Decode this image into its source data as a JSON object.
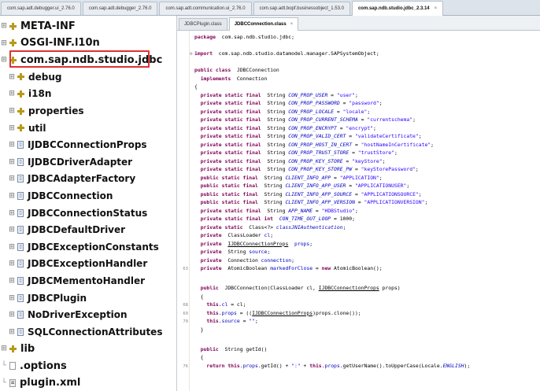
{
  "top_tabs": [
    {
      "label": "com.sap.adt.debugger.ui_2.76.0",
      "active": false
    },
    {
      "label": "com.sap.adt.debugger_2.76.0",
      "active": false
    },
    {
      "label": "com.sap.adt.communication.ui_2.76.0",
      "active": false
    },
    {
      "label": "com.sap.adt.bopf.businessobject_1.53.0",
      "active": false
    },
    {
      "label": "com.sap.ndb.studio.jdbc_2.3.14",
      "active": true,
      "close": "×"
    }
  ],
  "tree": [
    {
      "label": "META-INF",
      "icon": "package-icon",
      "level": 0
    },
    {
      "label": "OSGI-INF.l10n",
      "icon": "package-icon",
      "level": 0
    },
    {
      "label": "com.sap.ndb.studio.jdbc",
      "icon": "package-icon",
      "level": 0,
      "selected": true
    },
    {
      "label": "debug",
      "icon": "package-icon",
      "level": 1
    },
    {
      "label": "i18n",
      "icon": "package-icon",
      "level": 1
    },
    {
      "label": "properties",
      "icon": "package-icon",
      "level": 1
    },
    {
      "label": "util",
      "icon": "package-icon",
      "level": 1
    },
    {
      "label": "IJDBCConnectionProps",
      "icon": "class-file-icon",
      "level": 1
    },
    {
      "label": "IJDBCDriverAdapter",
      "icon": "class-file-icon",
      "level": 1
    },
    {
      "label": "JDBCAdapterFactory",
      "icon": "class-file-icon",
      "level": 1
    },
    {
      "label": "JDBCConnection",
      "icon": "class-file-icon",
      "level": 1
    },
    {
      "label": "JDBCConnectionStatus",
      "icon": "class-file-icon",
      "level": 1
    },
    {
      "label": "JDBCDefaultDriver",
      "icon": "class-file-icon",
      "level": 1
    },
    {
      "label": "JDBCExceptionConstants",
      "icon": "class-file-icon",
      "level": 1
    },
    {
      "label": "JDBCExceptionHandler",
      "icon": "class-file-icon",
      "level": 1
    },
    {
      "label": "JDBCMementoHandler",
      "icon": "class-file-icon",
      "level": 1
    },
    {
      "label": "JDBCPlugin",
      "icon": "class-file-icon",
      "level": 1
    },
    {
      "label": "NoDriverException",
      "icon": "class-file-icon",
      "level": 1
    },
    {
      "label": "SQLConnectionAttributes",
      "icon": "class-file-icon",
      "level": 1
    },
    {
      "label": "lib",
      "icon": "package-icon",
      "level": 0
    },
    {
      "label": ".options",
      "icon": "file-icon",
      "level": 0
    },
    {
      "label": "plugin.xml",
      "icon": "xml-file-icon",
      "level": 0
    }
  ],
  "editor_tabs": [
    {
      "label": "JDBCPlugin.class",
      "active": false
    },
    {
      "label": "JDBCConnection.class",
      "active": true,
      "close": "×"
    }
  ],
  "code_lines": [
    {
      "ln": "",
      "fold": "",
      "t": [
        [
          "kw",
          "package"
        ],
        [
          "",
          "  com.sap.ndb.studio.jdbc;"
        ]
      ]
    },
    {
      "ln": "",
      "fold": "",
      "t": []
    },
    {
      "ln": "",
      "fold": "⊕",
      "t": [
        [
          "kw",
          "import"
        ],
        [
          "",
          "  com.sap.ndb.studio.datamodel.manager.SAPSystemObject;"
        ]
      ]
    },
    {
      "ln": "",
      "fold": "",
      "t": []
    },
    {
      "ln": "",
      "fold": "",
      "t": [
        [
          "kw",
          "public class"
        ],
        [
          "",
          "  JDBCConnection"
        ]
      ]
    },
    {
      "ln": "",
      "fold": "",
      "t": [
        [
          "",
          "  "
        ],
        [
          "kw",
          "implements"
        ],
        [
          "",
          "  Connection"
        ]
      ]
    },
    {
      "ln": "",
      "fold": "",
      "t": [
        [
          "",
          "{"
        ]
      ]
    },
    {
      "ln": "",
      "fold": "",
      "t": [
        [
          "kw",
          "  private static final"
        ],
        [
          "",
          "  String "
        ],
        [
          "fld",
          "CON_PROP_USER"
        ],
        [
          "",
          " = "
        ],
        [
          "str",
          "\"user\""
        ],
        [
          "",
          ";"
        ]
      ]
    },
    {
      "ln": "",
      "fold": "",
      "t": [
        [
          "kw",
          "  private static final"
        ],
        [
          "",
          "  String "
        ],
        [
          "fld",
          "CON_PROP_PASSWORD"
        ],
        [
          "",
          " = "
        ],
        [
          "str",
          "\"password\""
        ],
        [
          "",
          ";"
        ]
      ]
    },
    {
      "ln": "",
      "fold": "",
      "t": [
        [
          "kw",
          "  private static final"
        ],
        [
          "",
          "  String "
        ],
        [
          "fld",
          "CON_PROP_LOCALE"
        ],
        [
          "",
          " = "
        ],
        [
          "str",
          "\"locale\""
        ],
        [
          "",
          ";"
        ]
      ]
    },
    {
      "ln": "",
      "fold": "",
      "t": [
        [
          "kw",
          "  private static final"
        ],
        [
          "",
          "  String "
        ],
        [
          "fld",
          "CON_PROP_CURRENT_SCHEMA"
        ],
        [
          "",
          " = "
        ],
        [
          "str",
          "\"currentschema\""
        ],
        [
          "",
          ";"
        ]
      ]
    },
    {
      "ln": "",
      "fold": "",
      "t": [
        [
          "kw",
          "  private static final"
        ],
        [
          "",
          "  String "
        ],
        [
          "fld",
          "CON_PROP_ENCRYPT"
        ],
        [
          "",
          " = "
        ],
        [
          "str",
          "\"encrypt\""
        ],
        [
          "",
          ";"
        ]
      ]
    },
    {
      "ln": "",
      "fold": "",
      "t": [
        [
          "kw",
          "  private static final"
        ],
        [
          "",
          "  String "
        ],
        [
          "fld",
          "CON_PROP_VALID_CERT"
        ],
        [
          "",
          " = "
        ],
        [
          "str",
          "\"validateCertificate\""
        ],
        [
          "",
          ";"
        ]
      ]
    },
    {
      "ln": "",
      "fold": "",
      "t": [
        [
          "kw",
          "  private static final"
        ],
        [
          "",
          "  String "
        ],
        [
          "fld",
          "CON_PROP_HOST_IN_CERT"
        ],
        [
          "",
          " = "
        ],
        [
          "str",
          "\"hostNameInCertificate\""
        ],
        [
          "",
          ";"
        ]
      ]
    },
    {
      "ln": "",
      "fold": "",
      "t": [
        [
          "kw",
          "  private static final"
        ],
        [
          "",
          "  String "
        ],
        [
          "fld",
          "CON_PROP_TRUST_STORE"
        ],
        [
          "",
          " = "
        ],
        [
          "str",
          "\"trustStore\""
        ],
        [
          "",
          ";"
        ]
      ]
    },
    {
      "ln": "",
      "fold": "",
      "t": [
        [
          "kw",
          "  private static final"
        ],
        [
          "",
          "  String "
        ],
        [
          "fld",
          "CON_PROP_KEY_STORE"
        ],
        [
          "",
          " = "
        ],
        [
          "str",
          "\"keyStore\""
        ],
        [
          "",
          ";"
        ]
      ]
    },
    {
      "ln": "",
      "fold": "",
      "t": [
        [
          "kw",
          "  private static final"
        ],
        [
          "",
          "  String "
        ],
        [
          "fld",
          "CON_PROP_KEY_STORE_PW"
        ],
        [
          "",
          " = "
        ],
        [
          "str",
          "\"keyStorePassword\""
        ],
        [
          "",
          ";"
        ]
      ]
    },
    {
      "ln": "",
      "fold": "",
      "t": [
        [
          "kw",
          "  public static final"
        ],
        [
          "",
          "  String "
        ],
        [
          "fld",
          "CLIENT_INFO_APP"
        ],
        [
          "",
          " = "
        ],
        [
          "str",
          "\"APPLICATION\""
        ],
        [
          "",
          ";"
        ]
      ]
    },
    {
      "ln": "",
      "fold": "",
      "t": [
        [
          "kw",
          "  public static final"
        ],
        [
          "",
          "  String "
        ],
        [
          "fld",
          "CLIENT_INFO_APP_USER"
        ],
        [
          "",
          " = "
        ],
        [
          "str",
          "\"APPLICATIONUSER\""
        ],
        [
          "",
          ";"
        ]
      ]
    },
    {
      "ln": "",
      "fold": "",
      "t": [
        [
          "kw",
          "  public static final"
        ],
        [
          "",
          "  String "
        ],
        [
          "fld",
          "CLIENT_INFO_APP_SOURCE"
        ],
        [
          "",
          " = "
        ],
        [
          "str",
          "\"APPLICATIONSOURCE\""
        ],
        [
          "",
          ";"
        ]
      ]
    },
    {
      "ln": "",
      "fold": "",
      "t": [
        [
          "kw",
          "  public static final"
        ],
        [
          "",
          "  String "
        ],
        [
          "fld",
          "CLIENT_INFO_APP_VERSION"
        ],
        [
          "",
          " = "
        ],
        [
          "str",
          "\"APPLICATIONVERSION\""
        ],
        [
          "",
          ";"
        ]
      ]
    },
    {
      "ln": "",
      "fold": "",
      "t": [
        [
          "kw",
          "  private static final"
        ],
        [
          "",
          "  String "
        ],
        [
          "fld",
          "APP_NAME"
        ],
        [
          "",
          " = "
        ],
        [
          "str",
          "\"HDBStudio\""
        ],
        [
          "",
          ";"
        ]
      ]
    },
    {
      "ln": "",
      "fold": "",
      "t": [
        [
          "kw",
          "  private static final int"
        ],
        [
          "",
          "  "
        ],
        [
          "fld",
          "CON_TIME_OUT_LOOP"
        ],
        [
          "",
          " = 1000;"
        ]
      ]
    },
    {
      "ln": "",
      "fold": "",
      "t": [
        [
          "kw",
          "  private static"
        ],
        [
          "",
          "  Class<?> "
        ],
        [
          "fld",
          "classJNIAuthentication"
        ],
        [
          "",
          ";"
        ]
      ]
    },
    {
      "ln": "",
      "fold": "",
      "t": [
        [
          "kw",
          "  private"
        ],
        [
          "",
          "  ClassLoader "
        ],
        [
          "stl",
          "cl"
        ],
        [
          "",
          ";"
        ]
      ]
    },
    {
      "ln": "",
      "fold": "",
      "t": [
        [
          "kw",
          "  private"
        ],
        [
          "",
          "  "
        ],
        [
          "und",
          "IJDBCConnectionProps"
        ],
        [
          "",
          "  "
        ],
        [
          "stl",
          "props"
        ],
        [
          "",
          ";"
        ]
      ]
    },
    {
      "ln": "",
      "fold": "",
      "t": [
        [
          "kw",
          "  private"
        ],
        [
          "",
          "  String "
        ],
        [
          "stl",
          "source"
        ],
        [
          "",
          ";"
        ]
      ]
    },
    {
      "ln": "",
      "fold": "",
      "t": [
        [
          "kw",
          "  private"
        ],
        [
          "",
          "  Connection "
        ],
        [
          "stl",
          "connection"
        ],
        [
          "",
          ";"
        ]
      ]
    },
    {
      "ln": "63",
      "fold": "",
      "t": [
        [
          "kw",
          "  private"
        ],
        [
          "",
          "  AtomicBoolean "
        ],
        [
          "stl",
          "markedForClose"
        ],
        [
          "",
          " = "
        ],
        [
          "kw",
          "new"
        ],
        [
          "",
          " AtomicBoolean();"
        ]
      ]
    },
    {
      "ln": "",
      "fold": "",
      "t": []
    },
    {
      "ln": "",
      "fold": "",
      "t": [
        [
          "kw",
          "  public"
        ],
        [
          "",
          "  JDBCConnection(ClassLoader cl, "
        ],
        [
          "und",
          "IJDBCConnectionProps"
        ],
        [
          "",
          " props)"
        ]
      ]
    },
    {
      "ln": "",
      "fold": "",
      "t": [
        [
          "",
          "  {"
        ]
      ]
    },
    {
      "ln": "68",
      "fold": "",
      "t": [
        [
          "kw",
          "    this"
        ],
        [
          "",
          "."
        ],
        [
          "stl",
          "cl"
        ],
        [
          "",
          " = cl;"
        ]
      ]
    },
    {
      "ln": "69",
      "fold": "",
      "t": [
        [
          "kw",
          "    this"
        ],
        [
          "",
          "."
        ],
        [
          "stl",
          "props"
        ],
        [
          "",
          " = (("
        ],
        [
          "und",
          "IJDBCConnectionProps"
        ],
        [
          "",
          ")props.clone());"
        ]
      ]
    },
    {
      "ln": "70",
      "fold": "",
      "t": [
        [
          "kw",
          "    this"
        ],
        [
          "",
          "."
        ],
        [
          "stl",
          "source"
        ],
        [
          "",
          " = "
        ],
        [
          "str",
          "\"\""
        ],
        [
          "",
          ";"
        ]
      ]
    },
    {
      "ln": "",
      "fold": "",
      "t": [
        [
          "",
          "  }"
        ]
      ]
    },
    {
      "ln": "",
      "fold": "",
      "t": []
    },
    {
      "ln": "",
      "fold": "",
      "t": [
        [
          "kw",
          "  public"
        ],
        [
          "",
          "  String getId()"
        ]
      ]
    },
    {
      "ln": "",
      "fold": "",
      "t": [
        [
          "",
          "  {"
        ]
      ]
    },
    {
      "ln": "76",
      "fold": "",
      "t": [
        [
          "kw",
          "    return this"
        ],
        [
          "",
          "."
        ],
        [
          "stl",
          "props"
        ],
        [
          "",
          ".getId() + "
        ],
        [
          "str",
          "\":\""
        ],
        [
          "",
          " + "
        ],
        [
          "kw",
          "this"
        ],
        [
          "",
          "."
        ],
        [
          "stl",
          "props"
        ],
        [
          "",
          ".getUserName().toUpperCase(Locale."
        ],
        [
          "fld",
          "ENGLISH"
        ],
        [
          "",
          ");"
        ]
      ]
    }
  ]
}
